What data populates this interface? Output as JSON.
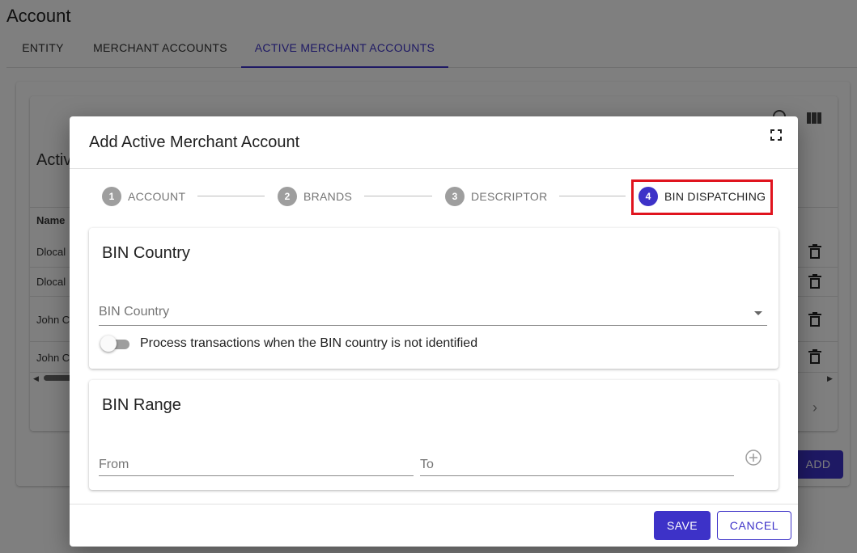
{
  "page": {
    "title": "Account",
    "tabs": [
      {
        "label": "ENTITY"
      },
      {
        "label": "MERCHANT ACCOUNTS"
      },
      {
        "label": "ACTIVE MERCHANT ACCOUNTS"
      }
    ]
  },
  "background_table": {
    "title_partial": "Activ",
    "column_name": "Name",
    "rows": [
      {
        "name": "Dlocal"
      },
      {
        "name": "Dlocal"
      },
      {
        "name": "John C"
      },
      {
        "name": "John C"
      }
    ],
    "add_label": "ADD"
  },
  "dialog": {
    "title": "Add Active Merchant Account",
    "steps": [
      {
        "number": "1",
        "label": "ACCOUNT"
      },
      {
        "number": "2",
        "label": "BRANDS"
      },
      {
        "number": "3",
        "label": "DESCRIPTOR"
      },
      {
        "number": "4",
        "label": "BIN DISPATCHING"
      }
    ],
    "active_step": 4,
    "bin_country": {
      "title": "BIN Country",
      "select_placeholder": "BIN Country",
      "toggle_label": "Process transactions when the BIN country is not identified",
      "toggle_on": false
    },
    "bin_range": {
      "title": "BIN Range",
      "from_placeholder": "From",
      "to_placeholder": "To"
    },
    "save_label": "SAVE",
    "cancel_label": "CANCEL"
  },
  "colors": {
    "accent": "#3d32c8",
    "highlight": "#e0141e"
  }
}
